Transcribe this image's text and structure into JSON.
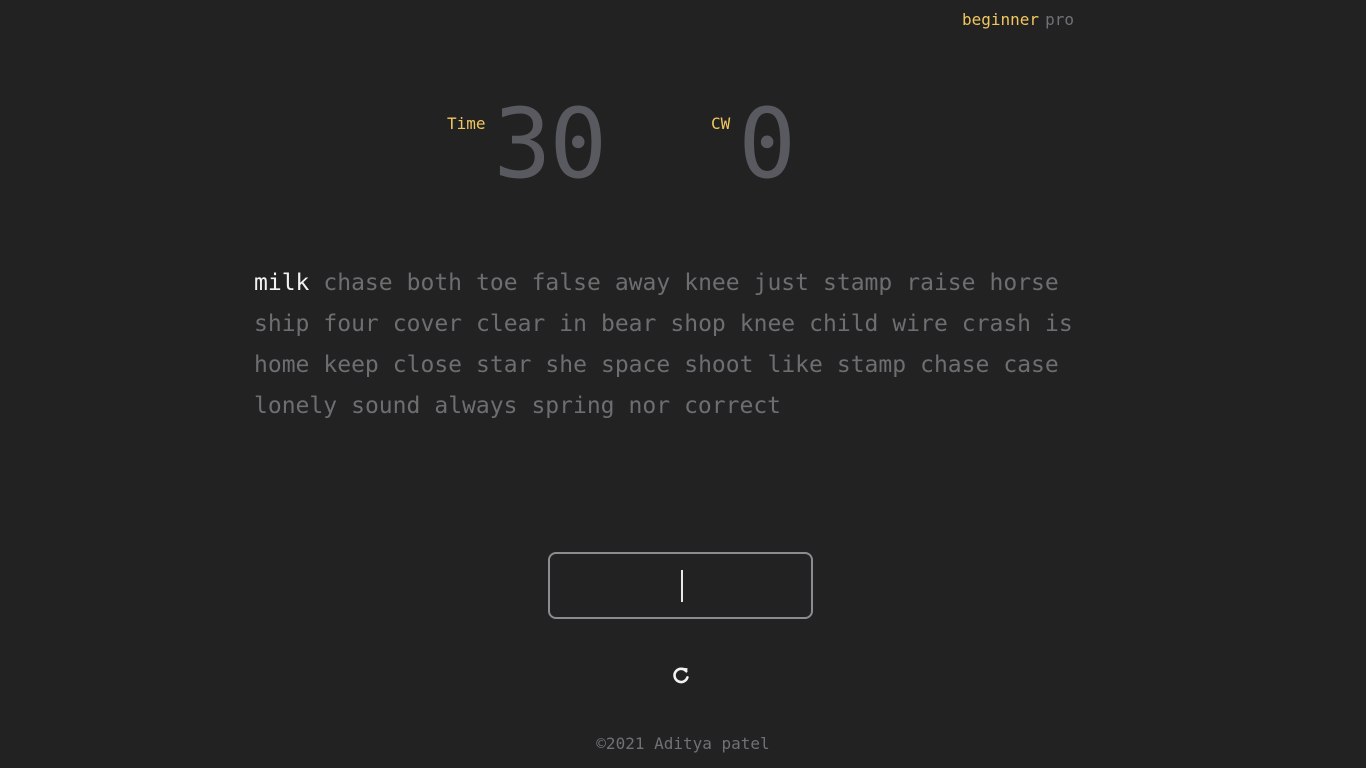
{
  "mode": {
    "beginner_label": "beginner",
    "pro_label": "pro",
    "active": "beginner"
  },
  "stats": {
    "time_label": "Time",
    "time_value": "30",
    "cw_label": "CW",
    "cw_value": "0"
  },
  "words": [
    "milk",
    "chase",
    "both",
    "toe",
    "false",
    "away",
    "knee",
    "just",
    "stamp",
    "raise",
    "horse",
    "ship",
    "four",
    "cover",
    "clear",
    "in",
    "bear",
    "shop",
    "knee",
    "child",
    "wire",
    "crash",
    "is",
    "home",
    "keep",
    "close",
    "star",
    "she",
    "space",
    "shoot",
    "like",
    "stamp",
    "chase",
    "case",
    "lonely",
    "sound",
    "always",
    "spring",
    "nor",
    "correct"
  ],
  "current_word_index": 0,
  "input": {
    "value": ""
  },
  "icons": {
    "reset": "refresh-icon"
  },
  "colors": {
    "background": "#222222",
    "accent": "#f0c75e",
    "muted": "#6c6e72",
    "current_word": "#f2f2f2",
    "stat_value": "#585a60"
  },
  "footer": {
    "text": "©2021 Aditya patel"
  }
}
